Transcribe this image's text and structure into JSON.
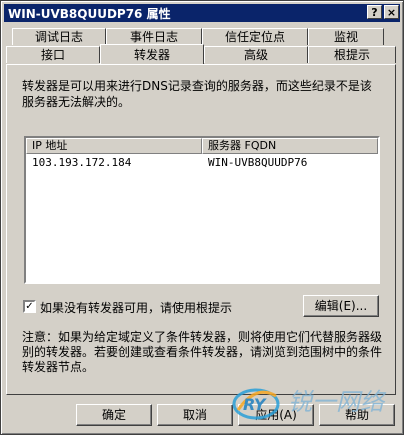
{
  "window": {
    "title": "WIN-UVB8QUUDP76 属性"
  },
  "titlebar_buttons": {
    "help": "?",
    "close": "×"
  },
  "tabs_row1": [
    "调试日志",
    "事件日志",
    "信任定位点",
    "监视"
  ],
  "tabs_row2": [
    "接口",
    "转发器",
    "高级",
    "根提示"
  ],
  "active_tab": "转发器",
  "description": "转发器是可以用来进行DNS记录查询的服务器，而这些纪录不是该服务器无法解决的。",
  "list": {
    "columns": [
      "IP 地址",
      "服务器 FQDN"
    ],
    "rows": [
      {
        "ip": "103.193.172.184",
        "fqdn": "WIN-UVB8QUUDP76"
      }
    ]
  },
  "use_root_hints": {
    "label": "如果没有转发器可用，请使用根提示",
    "checked": true,
    "mark": "✓"
  },
  "edit_button": "编辑(E)...",
  "note": "注意：如果为给定域定义了条件转发器，则将使用它们代替服务器级别的转发器。若要创建或查看条件转发器，请浏览到范围树中的条件转发器节点。",
  "buttons": {
    "ok": "确定",
    "cancel": "取消",
    "apply": "应用(A)",
    "help": "帮助"
  },
  "watermark": {
    "logo": "RY",
    "text": "锐一网络"
  }
}
